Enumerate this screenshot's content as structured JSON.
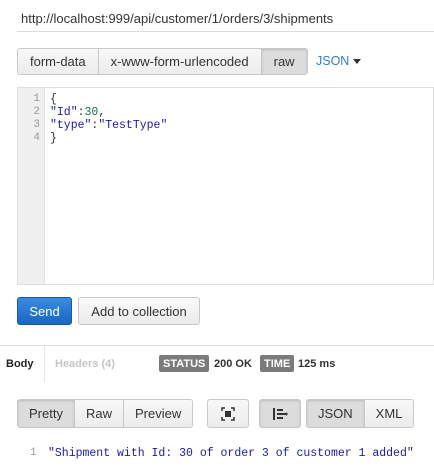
{
  "request": {
    "url": "http://localhost:999/api/customer/1/orders/3/shipments",
    "body_types": [
      "form-data",
      "x-www-form-urlencoded",
      "raw"
    ],
    "active_body_type": "raw",
    "language": "JSON"
  },
  "editor": {
    "line_numbers": [
      "1",
      "2",
      "3",
      "4"
    ],
    "l1_brace": "{",
    "l2_key": "\"Id\"",
    "l2_colon": ":",
    "l2_value": "30",
    "l2_comma": ",",
    "l3_key": "\"type\"",
    "l3_colon": ":",
    "l3_value": "\"TestType\"",
    "l4_brace": "}"
  },
  "actions": {
    "send": "Send",
    "add_to_collection": "Add to collection"
  },
  "response_tabs": {
    "body": "Body",
    "headers": "Headers (4)"
  },
  "status": {
    "status_label": "STATUS",
    "status_value": "200 OK",
    "time_label": "TIME",
    "time_value": "125 ms"
  },
  "format": {
    "views": [
      "Pretty",
      "Raw",
      "Preview"
    ],
    "active_view": "Pretty",
    "langs": [
      "JSON",
      "XML"
    ],
    "active_lang": "JSON"
  },
  "response": {
    "line_number": "1",
    "text": "\"Shipment with Id: 30 of order 3 of customer 1 added\""
  },
  "icons": [
    "fullscreen-icon",
    "wrap-icon",
    "chevron-down-icon"
  ]
}
